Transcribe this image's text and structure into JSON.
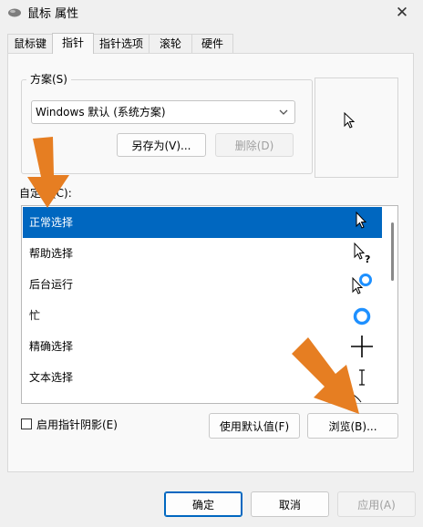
{
  "window": {
    "title": "鼠标 属性",
    "close_glyph": "✕"
  },
  "tabs": [
    {
      "label": "鼠标键",
      "active": false
    },
    {
      "label": "指针",
      "active": true
    },
    {
      "label": "指针选项",
      "active": false
    },
    {
      "label": "滚轮",
      "active": false
    },
    {
      "label": "硬件",
      "active": false
    }
  ],
  "scheme": {
    "group_label": "方案(S)",
    "selected_value": "Windows 默认 (系统方案)",
    "save_as_label": "另存为(V)...",
    "delete_label": "删除(D)"
  },
  "customize": {
    "label": "自定义(C):",
    "items": [
      {
        "label": "正常选择",
        "icon": "normal-select-cursor-icon",
        "selected": true
      },
      {
        "label": "帮助选择",
        "icon": "help-select-cursor-icon",
        "selected": false
      },
      {
        "label": "后台运行",
        "icon": "working-in-background-cursor-icon",
        "selected": false
      },
      {
        "label": "忙",
        "icon": "busy-cursor-icon",
        "selected": false
      },
      {
        "label": "精确选择",
        "icon": "precision-select-cursor-icon",
        "selected": false
      },
      {
        "label": "文本选择",
        "icon": "text-select-cursor-icon",
        "selected": false
      }
    ]
  },
  "options": {
    "shadow_label": "启用指针阴影(E)",
    "shadow_checked": false,
    "use_default_label": "使用默认值(F)",
    "browse_label": "浏览(B)..."
  },
  "footer": {
    "ok_label": "确定",
    "cancel_label": "取消",
    "apply_label": "应用(A)"
  },
  "colors": {
    "accent": "#0067c0",
    "annotation_arrow": "#e67e22",
    "busy_ring": "#1e90ff"
  }
}
